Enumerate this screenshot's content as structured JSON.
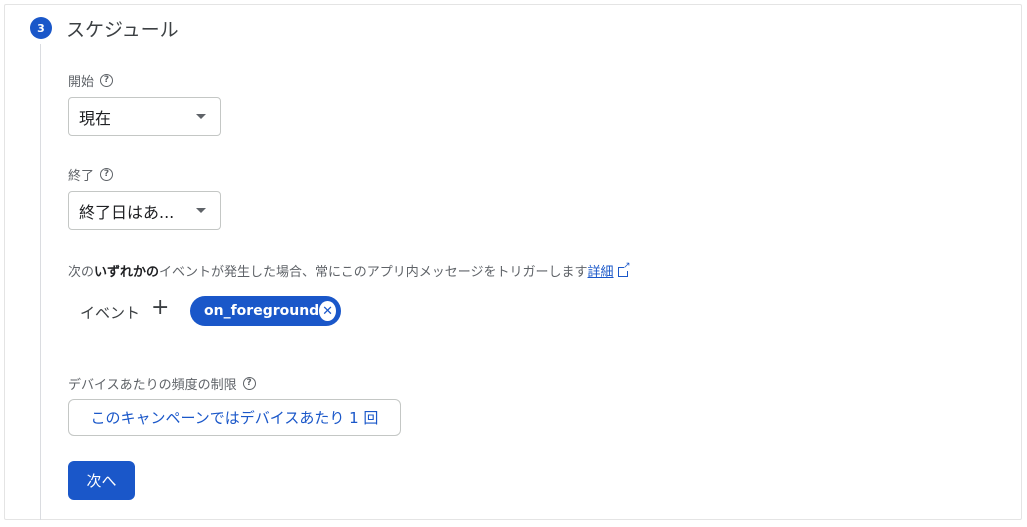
{
  "step": {
    "number": "3",
    "title": "スケジュール"
  },
  "start": {
    "label": "開始",
    "value": "現在"
  },
  "end": {
    "label": "終了",
    "value": "終了日はあ..."
  },
  "trigger": {
    "prefix": "次の",
    "emphasis": "いずれかの",
    "suffix": "イベントが発生した場合、常にこのアプリ内メッセージをトリガーします",
    "link": "詳細"
  },
  "events": {
    "label": "イベント",
    "chips": [
      "on_foreground"
    ]
  },
  "frequency": {
    "label": "デバイスあたりの頻度の制限",
    "value": "このキャンペーンではデバイスあたり 1 回"
  },
  "next_button": "次へ",
  "colors": {
    "primary": "#1a57c9",
    "text_secondary": "#5f6368"
  },
  "icons": {
    "help": "help-icon",
    "dropdown": "dropdown-arrow-icon",
    "add": "add-icon",
    "close": "close-icon",
    "external": "external-link-icon"
  }
}
